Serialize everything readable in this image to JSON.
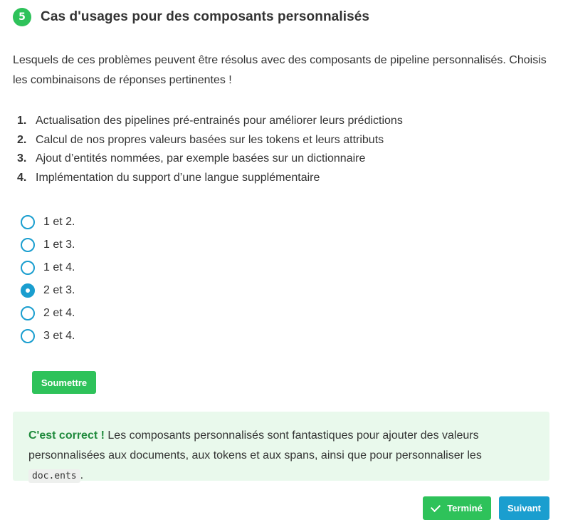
{
  "header": {
    "step_number": "5",
    "title": "Cas d'usages pour des composants personnalisés"
  },
  "question": "Lesquels de ces problèmes peuvent être résolus avec des composants de pipeline personnalisés. Choisis les combinaisons de réponses pertinentes !",
  "options": [
    {
      "number": "1.",
      "text": "Actualisation des pipelines pré-entrainés pour améliorer leurs prédictions"
    },
    {
      "number": "2.",
      "text": "Calcul de nos propres valeurs basées sur les tokens et leurs attributs"
    },
    {
      "number": "3.",
      "text": "Ajout d’entités nommées, par exemple basées sur un dictionnaire"
    },
    {
      "number": "4.",
      "text": "Implémentation du support d’une langue supplémentaire"
    }
  ],
  "answers": [
    {
      "label": "1 et 2.",
      "selected": false
    },
    {
      "label": "1 et 3.",
      "selected": false
    },
    {
      "label": "1 et 4.",
      "selected": false
    },
    {
      "label": "2 et 3.",
      "selected": true
    },
    {
      "label": "2 et 4.",
      "selected": false
    },
    {
      "label": "3 et 4.",
      "selected": false
    }
  ],
  "submit_label": "Soumettre",
  "feedback": {
    "strong": "C'est correct !",
    "text": " Les composants personnalisés sont fantastiques pour ajouter des valeurs personnalisées aux documents, aux tokens et aux spans, ainsi que pour personnaliser les ",
    "code": "doc.ents",
    "end": "."
  },
  "footer": {
    "done_label": "Terminé",
    "next_label": "Suivant"
  },
  "colors": {
    "green": "#2ec25a",
    "blue": "#1a9ecf",
    "feedback_bg": "#e9f9ec"
  }
}
